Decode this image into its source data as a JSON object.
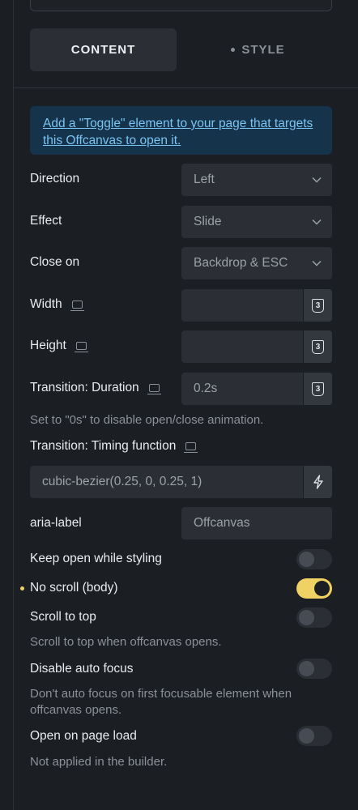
{
  "tabs": {
    "content": "CONTENT",
    "style": "STYLE"
  },
  "info": {
    "text": "Add a \"Toggle\" element to your page that targets this Offcanvas to open it."
  },
  "controls": {
    "direction": {
      "label": "Direction",
      "value": "Left"
    },
    "effect": {
      "label": "Effect",
      "value": "Slide"
    },
    "close_on": {
      "label": "Close on",
      "value": "Backdrop & ESC"
    },
    "width": {
      "label": "Width",
      "value": ""
    },
    "height": {
      "label": "Height",
      "value": ""
    },
    "duration": {
      "label": "Transition: Duration",
      "value": "0.2s",
      "help": "Set to \"0s\" to disable open/close animation."
    },
    "timing": {
      "label": "Transition: Timing function",
      "value": "cubic-bezier(0.25, 0, 0.25, 1)"
    },
    "aria": {
      "label": "aria-label",
      "value": "Offcanvas"
    },
    "keep_open": {
      "label": "Keep open while styling",
      "on": false
    },
    "no_scroll": {
      "label": "No scroll (body)",
      "on": true
    },
    "scroll_top": {
      "label": "Scroll to top",
      "on": false,
      "help": "Scroll to top when offcanvas opens."
    },
    "disable_focus": {
      "label": "Disable auto focus",
      "on": false,
      "help": "Don't auto focus on first focusable element when offcanvas opens."
    },
    "open_load": {
      "label": "Open on page load",
      "on": false,
      "help": "Not applied in the builder."
    }
  },
  "colors": {
    "accent": "#f0d264",
    "info_bg": "#15334b",
    "info_text": "#7cc3f2"
  },
  "icons": {
    "select": "chevron-down-icon",
    "css": "css3-icon",
    "dynamic": "bolt-icon",
    "responsive": "monitor-icon"
  }
}
